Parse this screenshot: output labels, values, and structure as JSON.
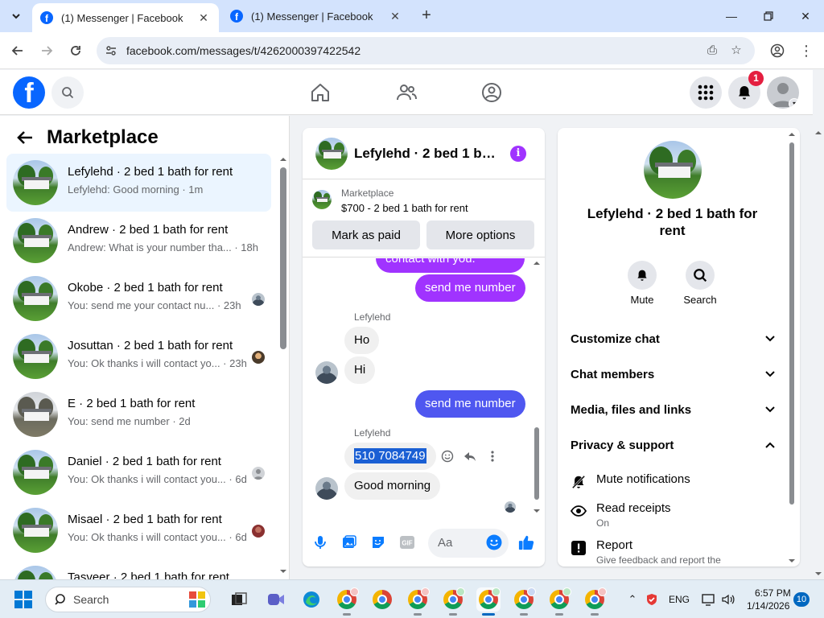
{
  "browser": {
    "tabs": [
      {
        "title": "(1) Messenger | Facebook",
        "active": true
      },
      {
        "title": "(1) Messenger | Facebook",
        "active": false
      }
    ],
    "url": "facebook.com/messages/t/4262000397422542"
  },
  "facebook": {
    "notification_count": "1"
  },
  "sidebar": {
    "title": "Marketplace",
    "conversations": [
      {
        "name": "Lefylehd · 2 bed 1 bath for rent",
        "preview": "Lefylehd: Good morning · 1m",
        "active": true,
        "thumb": "house"
      },
      {
        "name": "Andrew · 2 bed 1 bath for rent",
        "preview": "Andrew: What is your number tha... · 18h",
        "thumb": "house"
      },
      {
        "name": "Okobe · 2 bed 1 bath for rent",
        "preview": "You: send me your contact nu... · 23h",
        "thumb": "house"
      },
      {
        "name": "Josuttan · 2 bed 1 bath for rent",
        "preview": "You: Ok thanks i will contact yo... · 23h",
        "thumb": "house"
      },
      {
        "name": "E · 2 bed 1 bath for rent",
        "preview": "You: send me number · 2d",
        "thumb": "house-gray"
      },
      {
        "name": "Daniel · 2 bed 1 bath for rent",
        "preview": "You: Ok thanks i will contact you... · 6d",
        "thumb": "house"
      },
      {
        "name": "Misael · 2 bed 1 bath for rent",
        "preview": "You: Ok thanks i will contact you... · 6d",
        "thumb": "house"
      },
      {
        "name": "Tasveer · 2 bed 1 bath for rent",
        "preview": "",
        "thumb": "house"
      }
    ]
  },
  "chat": {
    "header_name": "Lefylehd · 2 bed 1 ba...",
    "listing_source": "Marketplace",
    "listing_title": "$700 - 2 bed 1 bath for rent",
    "mark_paid": "Mark as paid",
    "more_options": "More options",
    "messages": {
      "out_partial": "contact with you.",
      "out1": "send me number",
      "sender1": "Lefylehd",
      "in1": "Ho",
      "in2": "Hi",
      "out2": "send me number",
      "sender2": "Lefylehd",
      "in3": "510 7084749",
      "in4": "Good morning"
    },
    "composer_placeholder": "Aa",
    "gif_label": "GIF"
  },
  "info_panel": {
    "name": "Lefylehd · 2 bed 1 bath for rent",
    "actions": [
      {
        "label": "Mute"
      },
      {
        "label": "Search"
      }
    ],
    "sections": [
      {
        "label": "Customize chat",
        "expanded": false
      },
      {
        "label": "Chat members",
        "expanded": false
      },
      {
        "label": "Media, files and links",
        "expanded": false
      },
      {
        "label": "Privacy & support",
        "expanded": true
      }
    ],
    "privacy_items": [
      {
        "label": "Mute notifications",
        "sub": "",
        "icon": "mute-bell-icon"
      },
      {
        "label": "Read receipts",
        "sub": "On",
        "icon": "eye-icon"
      },
      {
        "label": "Report",
        "sub": "Give feedback and report the",
        "icon": "report-icon"
      }
    ]
  },
  "taskbar": {
    "search_placeholder": "Search",
    "language": "ENG",
    "time": "6:57 PM",
    "date": "1/14/2026",
    "notification_count": "10"
  },
  "colors": {
    "fb_blue": "#0866ff",
    "messenger_purple": "#a033ff",
    "bubble_blue": "#4f57f0",
    "selection": "#1a5fd4"
  }
}
